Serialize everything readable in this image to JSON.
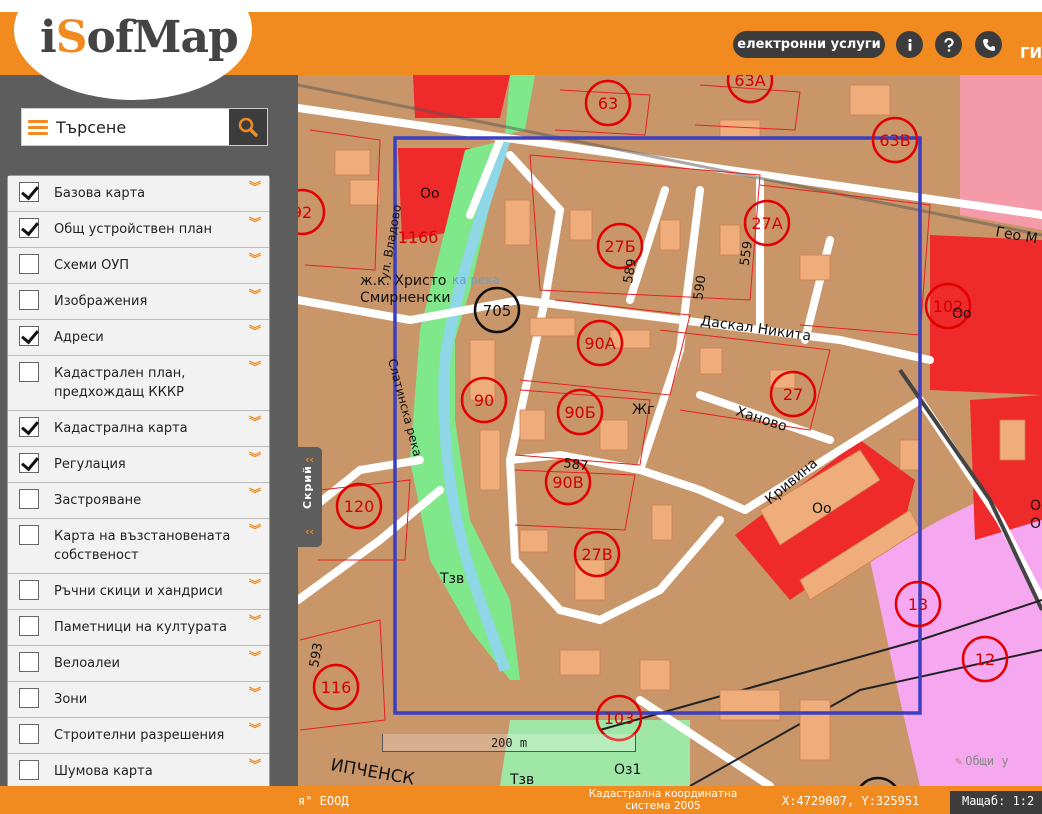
{
  "app": {
    "logo_prefix": "i",
    "logo_mark": "S",
    "logo_rest": "ofMap",
    "gis_tab": "ГИ"
  },
  "header": {
    "eservices_label": "електронни услуги",
    "info_icon": "info-icon",
    "help_icon": "help-icon",
    "phone_icon": "phone-icon"
  },
  "search": {
    "value": "Търсене"
  },
  "sidebar": {
    "hide_label": "Скрий",
    "layers": [
      {
        "label": "Базова карта",
        "checked": true
      },
      {
        "label": "Общ устройствен план",
        "checked": true
      },
      {
        "label": "Схеми ОУП",
        "checked": false
      },
      {
        "label": "Изображения",
        "checked": false
      },
      {
        "label": "Адреси",
        "checked": true
      },
      {
        "label": "Кадастрален план, предхождащ КККР",
        "checked": false
      },
      {
        "label": "Кадастрална карта",
        "checked": true
      },
      {
        "label": "Регулация",
        "checked": true
      },
      {
        "label": "Застрояване",
        "checked": false
      },
      {
        "label": "Карта на възстановената собственост",
        "checked": false
      },
      {
        "label": "Ръчни скици и хандриси",
        "checked": false
      },
      {
        "label": "Паметници на културата",
        "checked": false
      },
      {
        "label": "Велоалеи",
        "checked": false
      },
      {
        "label": "Зони",
        "checked": false
      },
      {
        "label": "Строителни разрешения",
        "checked": false
      },
      {
        "label": "Шумова карта",
        "checked": false
      }
    ]
  },
  "map": {
    "scale_label": "200 m",
    "shared_label": "Общи у",
    "labels": {
      "district": "ж.к. Христо",
      "district2": "Смирненски",
      "river": "ка река",
      "street_vladovo": "ул. Владово",
      "street_slatinska": "Слатинска река",
      "street_daskal": "Даскал Никита",
      "street_hanovo": "Ханово",
      "street_krivina": "Кривина",
      "street_geo": "Гео М",
      "street_bottom": "ИПЧЕНСК",
      "zone_tzv": "Тзв",
      "zone_tzv2": "Тзв",
      "zone_oz": "Оз1",
      "zone_zh": "Жг",
      "zone_oo1": "Оо",
      "zone_oo2": "Оо",
      "zone_oo3": "Оо",
      "zone_oo4": "Оо",
      "zone_o": "О",
      "block_116b": "116б",
      "n589": "589",
      "n590": "590",
      "n559": "559",
      "n587": "587",
      "n593": "593",
      "p63": "63",
      "p63a": "63А",
      "p63b": "63В",
      "p27a": "27А",
      "p27b": "27Б",
      "p27": "27",
      "p27v": "27В",
      "p705": "705",
      "p90a": "90А",
      "p90": "90",
      "p90b": "90Б",
      "p90v": "90В",
      "p120": "120",
      "p116": "116",
      "p103": "103",
      "p102": "102",
      "p13": "13",
      "p12": "12",
      "p92": "92"
    }
  },
  "footer": {
    "company": "я\" ЕООД",
    "crs_line1": "Кадастрална координатна",
    "crs_line2": "система 2005",
    "coords": "X:4729007, Y:325951",
    "scale": "Мащаб: 1:2"
  },
  "colors": {
    "accent": "#f28b1f",
    "dark": "#3c3c3c",
    "sidebar": "#5d5d5d",
    "select_box": "#3b3fc0"
  }
}
